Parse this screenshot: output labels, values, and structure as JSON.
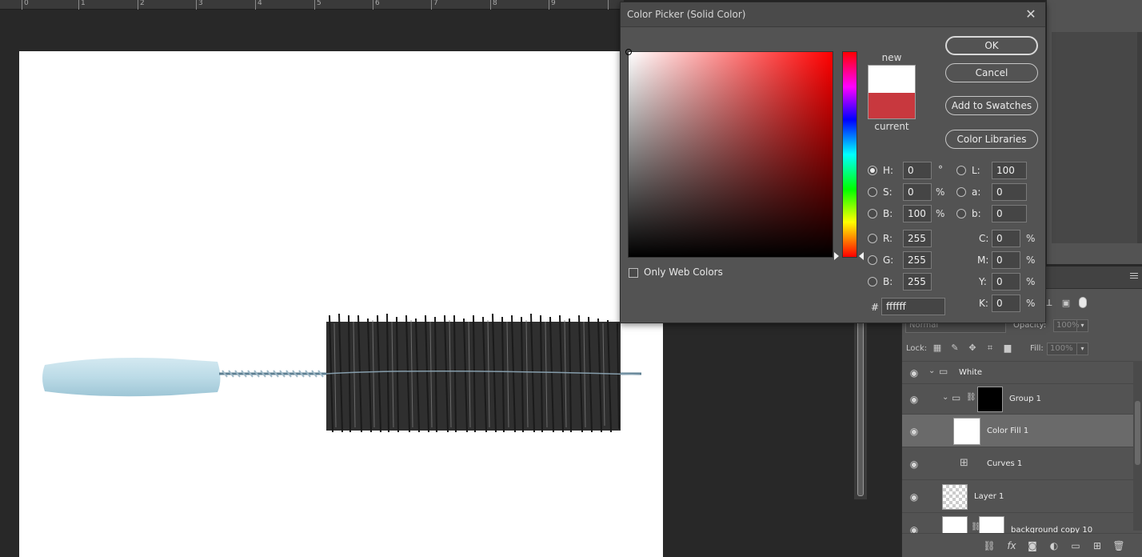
{
  "ruler": {
    "labels": [
      "0",
      "1",
      "2",
      "3",
      "4",
      "5",
      "6",
      "7",
      "8",
      "9"
    ]
  },
  "dialog": {
    "title": "Color Picker (Solid Color)",
    "new_label": "new",
    "current_label": "current",
    "new_color": "#ffffff",
    "current_color": "#c8383e",
    "only_web_colors": "Only Web Colors",
    "buttons": {
      "ok": "OK",
      "cancel": "Cancel",
      "add_swatches": "Add to Swatches",
      "color_libraries": "Color Libraries"
    },
    "hsb": {
      "h": {
        "label": "H:",
        "value": "0",
        "unit": "°"
      },
      "s": {
        "label": "S:",
        "value": "0",
        "unit": "%"
      },
      "b": {
        "label": "B:",
        "value": "100",
        "unit": "%"
      }
    },
    "rgb": {
      "r": {
        "label": "R:",
        "value": "255"
      },
      "g": {
        "label": "G:",
        "value": "255"
      },
      "b": {
        "label": "B:",
        "value": "255"
      }
    },
    "lab": {
      "l": {
        "label": "L:",
        "value": "100"
      },
      "a": {
        "label": "a:",
        "value": "0"
      },
      "b": {
        "label": "b:",
        "value": "0"
      }
    },
    "cmyk": {
      "c": {
        "label": "C:",
        "value": "0",
        "unit": "%"
      },
      "m": {
        "label": "M:",
        "value": "0",
        "unit": "%"
      },
      "y": {
        "label": "Y:",
        "value": "0",
        "unit": "%"
      },
      "k": {
        "label": "K:",
        "value": "0",
        "unit": "%"
      }
    },
    "hex": {
      "label": "#",
      "value": "ffffff"
    }
  },
  "layers": {
    "blend_mode": "Normal",
    "opacity_label": "Opacity:",
    "opacity_value": "100%",
    "lock_label": "Lock:",
    "fill_label": "Fill:",
    "fill_value": "100%",
    "items": [
      {
        "name": "White"
      },
      {
        "name": "Group 1"
      },
      {
        "name": "Color Fill 1"
      },
      {
        "name": "Curves 1"
      },
      {
        "name": "Layer 1"
      },
      {
        "name": "background copy 10"
      }
    ]
  }
}
